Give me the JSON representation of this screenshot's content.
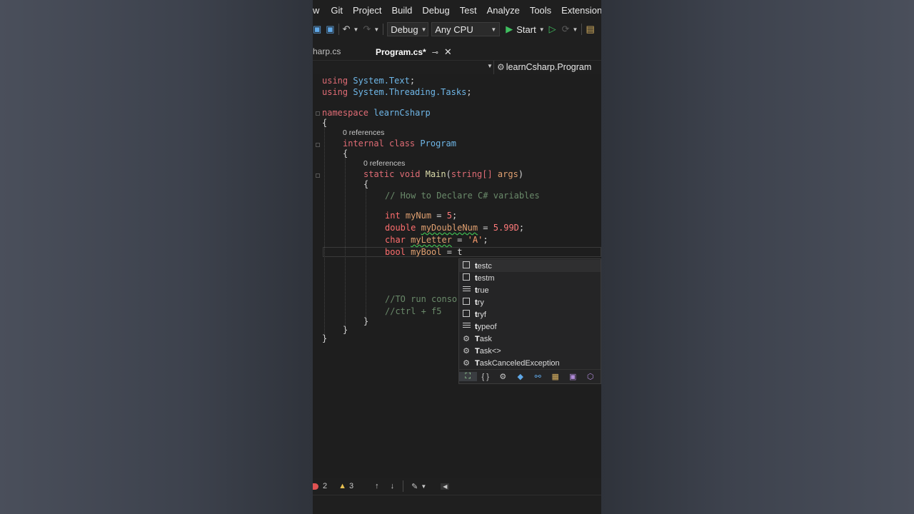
{
  "menu": [
    "w",
    "Git",
    "Project",
    "Build",
    "Debug",
    "Test",
    "Analyze",
    "Tools",
    "Extensions"
  ],
  "toolbar": {
    "config": "Debug",
    "platform": "Any CPU",
    "start_label": "Start"
  },
  "tabs": {
    "inactive": "harp.cs",
    "active": "Program.cs*"
  },
  "navbar": {
    "class_path": "learnCsharp.Program"
  },
  "code": {
    "using1_kw": "using",
    "using1_ns": "System.Text",
    "using1_end": ";",
    "using2_kw": "using",
    "using2_ns": "System.Threading.Tasks",
    "using2_end": ";",
    "ns_kw": "namespace",
    "ns_name": "learnCsharp",
    "brace_open": "{",
    "brace_close": "}",
    "refs_class": "0 references",
    "class_kw1": "internal",
    "class_kw2": "class",
    "class_name": "Program",
    "refs_main": "0 references",
    "main_kw1": "static",
    "main_kw2": "void",
    "main_name": "Main",
    "main_params_open": "(",
    "main_param_type": "string[]",
    "main_param_name": "args",
    "main_params_close": ")",
    "comment1": "// How to Declare C# variables",
    "l_int_type": "int",
    "l_int_var": "myNum",
    "l_int_eq": " = ",
    "l_int_val": "5",
    "l_int_end": ";",
    "l_dbl_type": "double",
    "l_dbl_var": "myDoubleNum",
    "l_dbl_eq": " = ",
    "l_dbl_val": "5.99D",
    "l_dbl_end": ";",
    "l_chr_type": "char",
    "l_chr_var": "myLetter",
    "l_chr_eq": " = ",
    "l_chr_val": "'A'",
    "l_chr_end": ";",
    "l_bool_type": "bool",
    "l_bool_var": "myBool",
    "l_bool_eq": " = ",
    "l_bool_val": "t",
    "comment2": "//TO run conso",
    "comment3": "//ctrl + f5"
  },
  "completion": {
    "typed": "t",
    "items": [
      {
        "bold": "t",
        "rest": "estc",
        "icon": "snippet-icon"
      },
      {
        "bold": "t",
        "rest": "estm",
        "icon": "snippet-icon"
      },
      {
        "bold": "t",
        "rest": "rue",
        "icon": "keyword-icon"
      },
      {
        "bold": "t",
        "rest": "ry",
        "icon": "snippet-icon"
      },
      {
        "bold": "t",
        "rest": "ryf",
        "icon": "snippet-icon"
      },
      {
        "bold": "t",
        "rest": "ypeof",
        "icon": "keyword-icon"
      },
      {
        "bold": "T",
        "rest": "ask",
        "icon": "class-icon"
      },
      {
        "bold": "T",
        "rest": "ask<>",
        "icon": "class-icon"
      },
      {
        "bold": "T",
        "rest": "askCanceledException",
        "icon": "class-icon"
      }
    ]
  },
  "errors": {
    "error_count": "2",
    "warning_count": "3"
  }
}
